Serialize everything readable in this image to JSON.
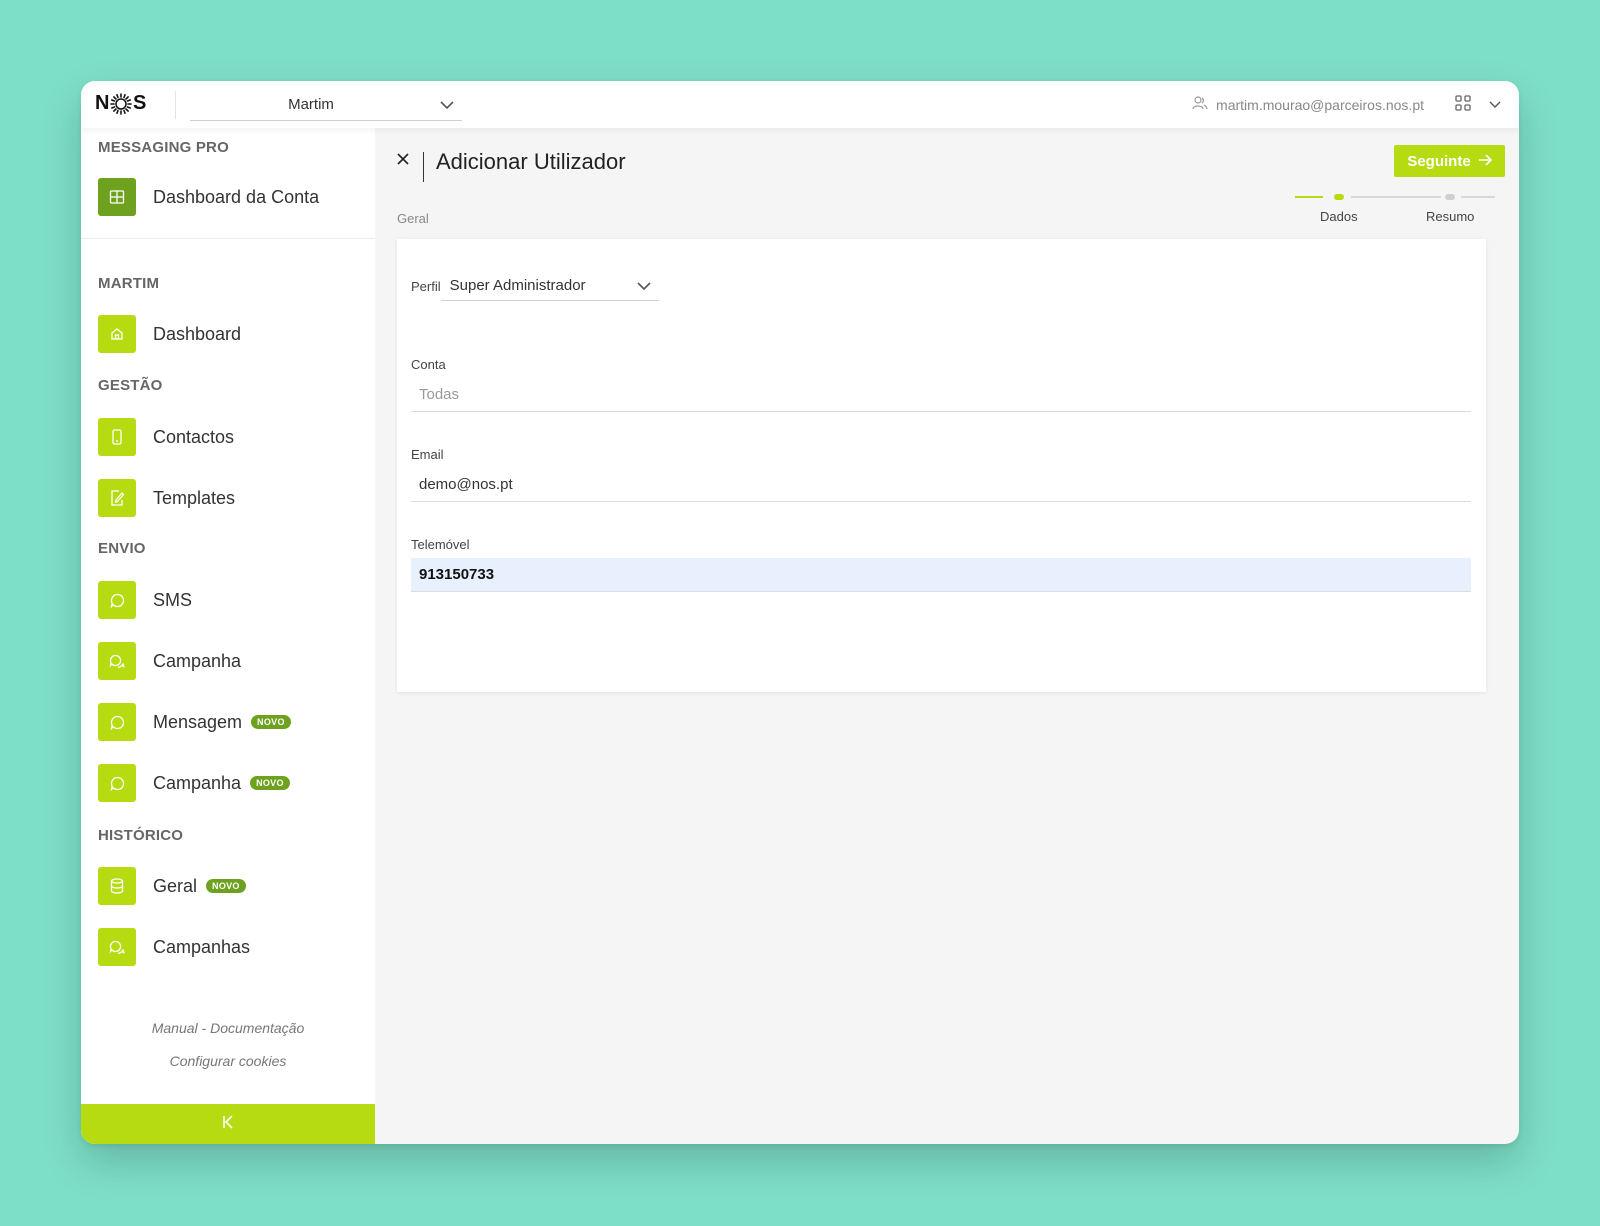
{
  "header": {
    "logo_text_left": "N",
    "logo_text_right": "S",
    "account_select": {
      "value": "Martim"
    },
    "user_email": "martim.mourao@parceiros.nos.pt"
  },
  "sidebar": {
    "sections": [
      {
        "title": "MESSAGING PRO",
        "items": [
          {
            "label": "Dashboard da Conta",
            "icon": "grid-icon"
          }
        ]
      },
      {
        "title": "MARTIM",
        "items": [
          {
            "label": "Dashboard",
            "icon": "home-icon"
          }
        ]
      },
      {
        "title": "GESTÃO",
        "items": [
          {
            "label": "Contactos",
            "icon": "phone-icon"
          },
          {
            "label": "Templates",
            "icon": "edit-icon"
          }
        ]
      },
      {
        "title": "ENVIO",
        "items": [
          {
            "label": "SMS",
            "icon": "chat-icon"
          },
          {
            "label": "Campanha",
            "icon": "chat-bubbles-icon"
          },
          {
            "label": "Mensagem",
            "icon": "chat-icon",
            "badge": "NOVO"
          },
          {
            "label": "Campanha",
            "icon": "chat-icon",
            "badge": "NOVO"
          }
        ]
      },
      {
        "title": "HISTÓRICO",
        "items": [
          {
            "label": "Geral",
            "icon": "database-icon",
            "badge": "NOVO"
          },
          {
            "label": "Campanhas",
            "icon": "chat-bubbles-icon"
          }
        ]
      }
    ],
    "footer_links": [
      "Manual - Documentação",
      "Configurar cookies"
    ],
    "collapse_glyph": "K"
  },
  "main": {
    "title": "Adicionar Utilizador",
    "next_button": "Seguinte",
    "breadcrumb": "Geral",
    "steps": [
      {
        "label": "Dados",
        "state": "active"
      },
      {
        "label": "Resumo",
        "state": "pending"
      }
    ],
    "form": {
      "perfil": {
        "label": "Perfil",
        "value": "Super Administrador"
      },
      "conta": {
        "label": "Conta",
        "placeholder": "Todas"
      },
      "email": {
        "label": "Email",
        "value": "demo@nos.pt"
      },
      "telemovel": {
        "label": "Telemóvel",
        "value": "913150733"
      }
    }
  },
  "colors": {
    "accent": "#b6db11",
    "accent_dark": "#6ea21e",
    "background": "#7ddfc6"
  }
}
